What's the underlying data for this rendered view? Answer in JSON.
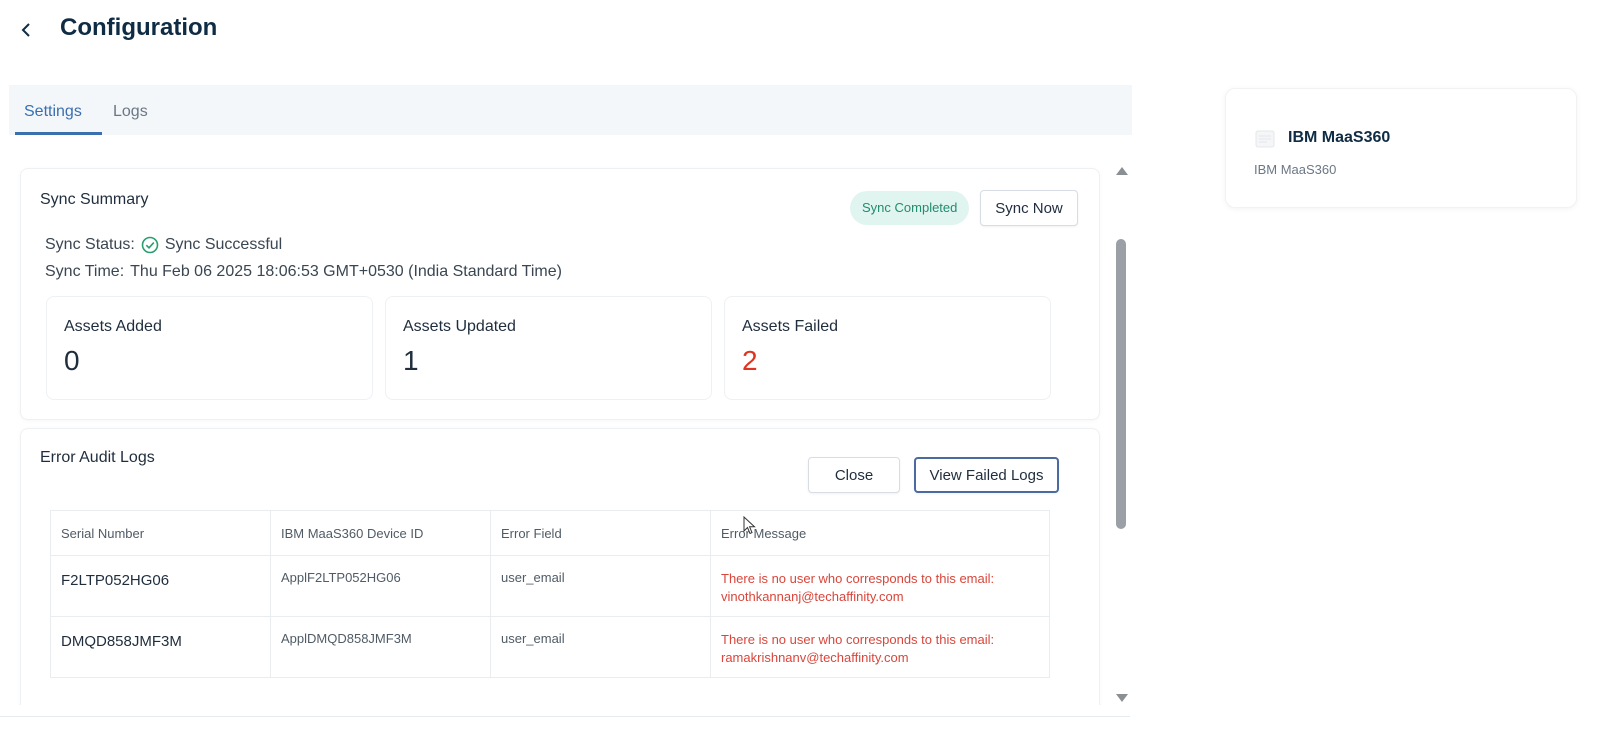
{
  "header": {
    "title": "Configuration"
  },
  "tabs": [
    {
      "label": "Settings",
      "active": true
    },
    {
      "label": "Logs",
      "active": false
    }
  ],
  "sync_summary": {
    "title": "Sync Summary",
    "badge": "Sync Completed",
    "sync_now_label": "Sync Now",
    "status_label": "Sync Status:",
    "status_value": "Sync Successful",
    "time_label": "Sync Time:",
    "time_value": "Thu Feb 06 2025 18:06:53 GMT+0530 (India Standard Time)",
    "stats": [
      {
        "label": "Assets Added",
        "value": "0"
      },
      {
        "label": "Assets Updated",
        "value": "1"
      },
      {
        "label": "Assets Failed",
        "value": "2"
      }
    ]
  },
  "error_audit": {
    "title": "Error Audit Logs",
    "close_label": "Close",
    "view_failed_label": "View Failed Logs",
    "columns": [
      "Serial Number",
      "IBM MaaS360 Device ID",
      "Error Field",
      "Error Message"
    ],
    "rows": [
      {
        "serial": "F2LTP052HG06",
        "device_id": "ApplF2LTP052HG06",
        "field": "user_email",
        "message_line1": "There is no user who corresponds to this email:",
        "message_line2": "vinothkannanj@techaffinity.com"
      },
      {
        "serial": "DMQD858JMF3M",
        "device_id": "ApplDMQD858JMF3M",
        "field": "user_email",
        "message_line1": "There is no user who corresponds to this email:",
        "message_line2": "ramakrishnanv@techaffinity.com"
      }
    ]
  },
  "integration": {
    "name": "IBM MaaS360",
    "subtitle": "IBM MaaS360",
    "icon": "document-icon"
  },
  "colors": {
    "accent": "#3a6fb0",
    "badge_bg": "#e0f5ef",
    "badge_text": "#228c6e",
    "success": "#2a9d6f",
    "error": "#d9463b",
    "failed_count": "#e0341e"
  }
}
